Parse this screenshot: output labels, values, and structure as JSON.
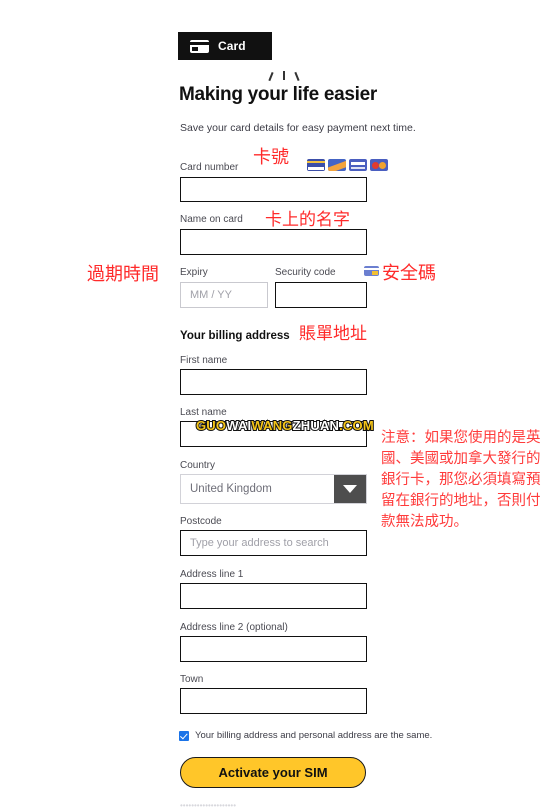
{
  "page": {
    "background": "#ffffff",
    "accent_yellow": "#ffc629",
    "annotation_red": "#ff3b3b",
    "checkbox_blue": "#1a73e8"
  },
  "tab": {
    "label": "Card",
    "icon": "credit-card-icon"
  },
  "heading": {
    "title": "Making your life easier",
    "subtitle": "Save your card details for easy payment next time."
  },
  "card_section": {
    "card_number": {
      "label": "Card number",
      "value": "",
      "placeholder": ""
    },
    "brands": [
      {
        "name": "visa-icon"
      },
      {
        "name": "amex-icon"
      },
      {
        "name": "maestro-icon"
      },
      {
        "name": "mastercard-icon"
      }
    ],
    "name_on_card": {
      "label": "Name on card",
      "value": "",
      "placeholder": ""
    },
    "expiry": {
      "label": "Expiry",
      "value": "",
      "placeholder": "MM / YY"
    },
    "security_code": {
      "label": "Security code",
      "value": "",
      "placeholder": ""
    }
  },
  "billing_section": {
    "title": "Your billing address",
    "first_name": {
      "label": "First name",
      "value": "",
      "placeholder": ""
    },
    "last_name": {
      "label": "Last name",
      "value": "",
      "placeholder": ""
    },
    "country": {
      "label": "Country",
      "selected": "United Kingdom",
      "options": [
        "United Kingdom"
      ]
    },
    "postcode": {
      "label": "Postcode",
      "value": "",
      "placeholder": "Type your address to search"
    },
    "address_line_1": {
      "label": "Address line 1",
      "value": "",
      "placeholder": ""
    },
    "address_line_2": {
      "label": "Address line 2 (optional)",
      "value": "",
      "placeholder": ""
    },
    "town": {
      "label": "Town",
      "value": "",
      "placeholder": ""
    }
  },
  "consent": {
    "checked": true,
    "text": "Your billing address and personal address are the same."
  },
  "cta": {
    "label": "Activate your SIM"
  },
  "annotations": {
    "card_number": "卡號",
    "name_on_card": "卡上的名字",
    "expiry": "過期時間",
    "security_code": "安全碼",
    "billing_address": "賬單地址",
    "note": "注意：如果您使用的是英國、美國或加拿大發行的銀行卡，那您必須填寫預留在銀行的地址，否則付款無法成功。"
  },
  "watermark": {
    "part1": "GUO",
    "part2": "WAI",
    "part3": "WANG",
    "part4": "ZHUAN",
    "part5": ".COM",
    "full": "GUOWAIWANGZHUAN.COM"
  },
  "bottom_faint": {
    "text": "••••••••••••••••••••"
  }
}
